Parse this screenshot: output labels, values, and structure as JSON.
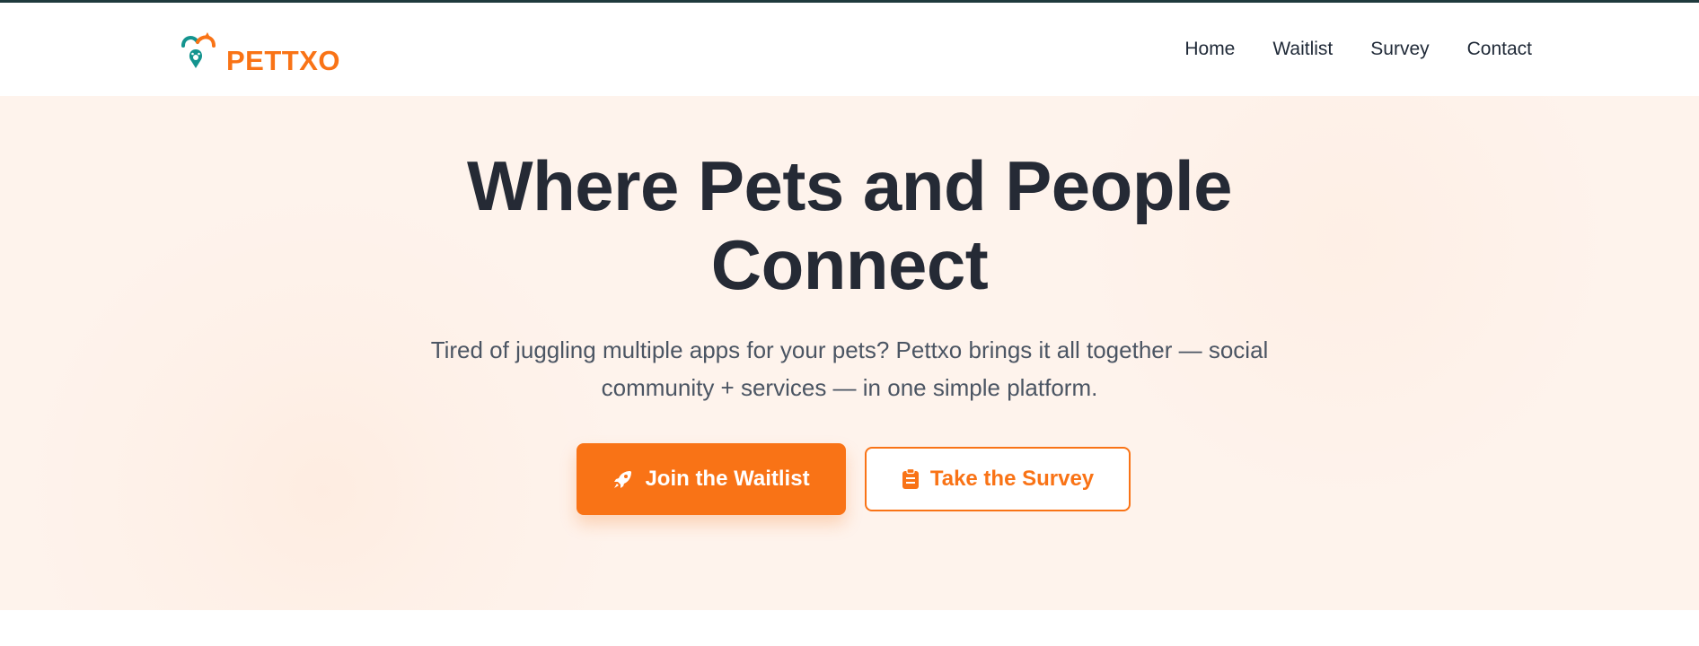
{
  "header": {
    "logo_text": "PETTXO",
    "logo_icon": "pet-heart-logo-icon",
    "nav": [
      {
        "label": "Home"
      },
      {
        "label": "Waitlist"
      },
      {
        "label": "Survey"
      },
      {
        "label": "Contact"
      }
    ]
  },
  "hero": {
    "title_line1": "Where Pets and People",
    "title_line2": "Connect",
    "subtitle_line1": "Tired of juggling multiple apps for your pets? Pettxo brings it all together — social",
    "subtitle_line2": "community + services — in one simple platform.",
    "primary_button": {
      "label": "Join the Waitlist",
      "icon": "rocket-icon"
    },
    "secondary_button": {
      "label": "Take the Survey",
      "icon": "clipboard-icon"
    }
  },
  "colors": {
    "accent": "#f97316",
    "teal": "#14948f",
    "hero_bg": "#fef3ec",
    "title": "#252a35",
    "text": "#4b5563",
    "top_border": "#1f3a3d"
  }
}
